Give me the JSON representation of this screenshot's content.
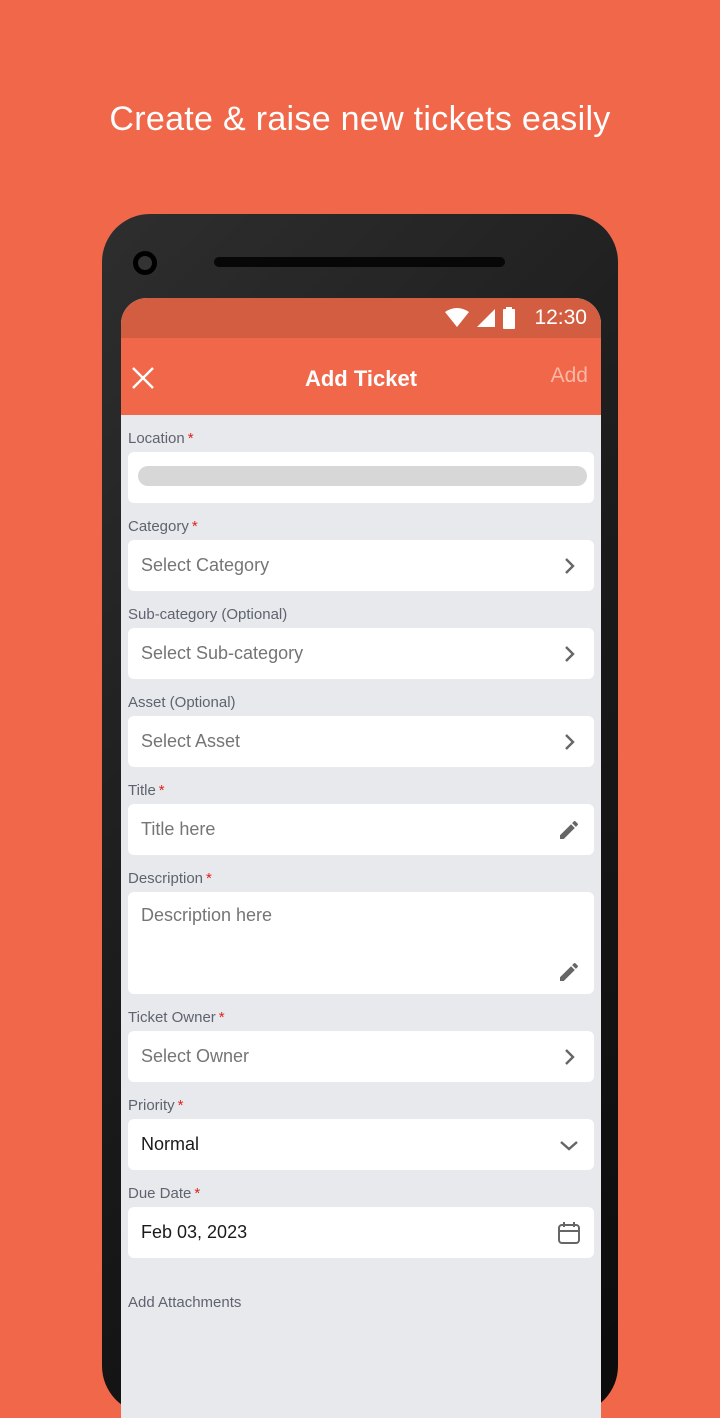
{
  "headline": "Create & raise new tickets easily",
  "status_bar": {
    "time": "12:30",
    "icons": [
      "wifi-icon",
      "signal-icon",
      "battery-icon"
    ]
  },
  "app_bar": {
    "title": "Add Ticket",
    "close_icon": "close-icon",
    "add_label": "Add"
  },
  "colors": {
    "brand": "#f1674a",
    "status_bar": "#d35d40",
    "required": "#e02020",
    "form_bg": "#e8e9ec"
  },
  "form": {
    "location": {
      "label": "Location",
      "required": "*",
      "value": ""
    },
    "category": {
      "label": "Category",
      "required": "*",
      "placeholder": "Select Category",
      "icon": "chevron-right-icon"
    },
    "subcategory": {
      "label": "Sub-category (Optional)",
      "placeholder": "Select Sub-category",
      "icon": "chevron-right-icon"
    },
    "asset": {
      "label": "Asset (Optional)",
      "placeholder": "Select Asset",
      "icon": "chevron-right-icon"
    },
    "title": {
      "label": "Title",
      "required": "*",
      "placeholder": "Title here",
      "icon": "pencil-icon"
    },
    "description": {
      "label": "Description",
      "required": "*",
      "placeholder": "Description here",
      "icon": "pencil-icon"
    },
    "owner": {
      "label": "Ticket Owner",
      "required": "*",
      "placeholder": "Select Owner",
      "icon": "chevron-right-icon"
    },
    "priority": {
      "label": "Priority",
      "required": "*",
      "value": "Normal",
      "icon": "chevron-down-icon"
    },
    "due_date": {
      "label": "Due Date",
      "required": "*",
      "value": "Feb 03, 2023",
      "icon": "calendar-icon"
    },
    "attachments": {
      "label": "Add Attachments"
    }
  }
}
